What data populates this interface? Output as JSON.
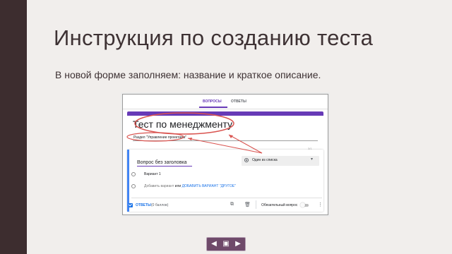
{
  "slide": {
    "title": "Инструкция по созданию теста",
    "subtitle": "В новой форме заполняем: название и краткое описание."
  },
  "form": {
    "tabs": [
      {
        "label": "ВОПРОСЫ"
      },
      {
        "label": "ОТВЕТЫ"
      }
    ],
    "title": "Тест по менеджменту",
    "description": "Раздел \"Управление проектами\"",
    "char_count": "3/1",
    "question": {
      "title": "Вопрос без заголовка",
      "type_label": "Один из списка",
      "option_1": "Вариант 1",
      "add_option_prefix": "Добавить вариант",
      "or_text": "или",
      "add_other_link": "ДОБАВИТЬ ВАРИАНТ \"ДРУГОЕ\"",
      "answers_label": "ОТВЕТЫ",
      "points_label": "(0 баллов)",
      "required_label": "Обязательный вопрос"
    }
  },
  "colors": {
    "accent": "#673ab7",
    "link": "#1a73e8",
    "annotation": "#d9534f",
    "sidebar": "#3d2d2f"
  },
  "icons": [
    "radio-icon",
    "chevron-down-icon",
    "copy-icon",
    "trash-icon",
    "more-vert-icon",
    "checkbox-icon",
    "nav-back-icon",
    "nav-home-icon",
    "nav-forward-icon"
  ]
}
